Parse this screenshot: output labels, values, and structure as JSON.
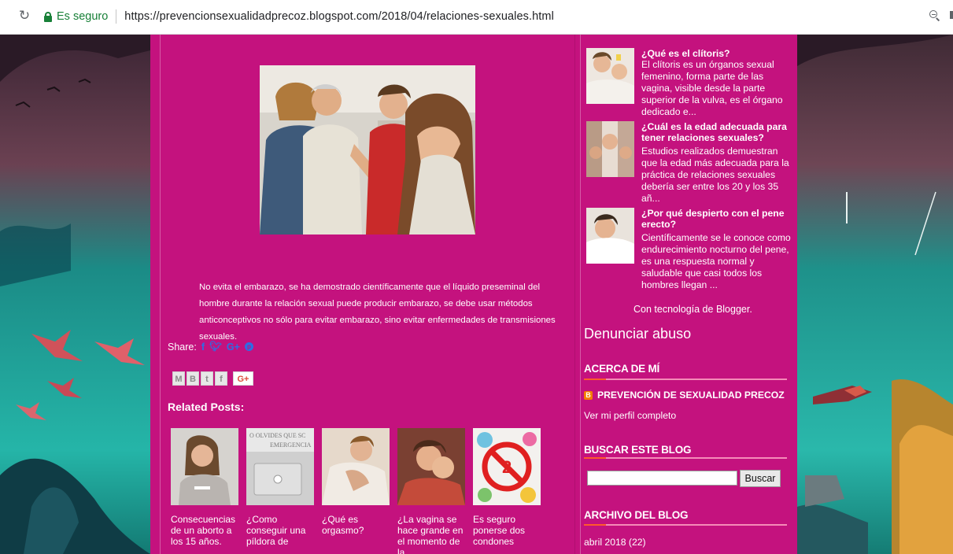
{
  "browser": {
    "secure_label": "Es seguro",
    "url": "https://prevencionsexualidadprecoz.blogspot.com/2018/04/relaciones-sexuales.html"
  },
  "post": {
    "body": "No evita el embarazo, se ha demostrado científicamente que el líquido preseminal  del hombre durante la relación sexual puede producir embarazo, se debe usar  métodos anticonceptivos no sólo para evitar embarazo, sino evitar enfermedades de transmisiones sexuales.",
    "share_label": "Share:",
    "share_icons": [
      "facebook-icon",
      "twitter-icon",
      "google-plus-icon",
      "pinterest-icon"
    ],
    "sharebar_icons": [
      "email-icon",
      "blogthis-icon",
      "twitter-icon",
      "facebook-icon",
      "google-plus-one-icon"
    ],
    "gplus_label": "G+"
  },
  "related": {
    "title": "Related Posts:",
    "items": [
      {
        "caption": "Consecuencias de un aborto a los 15 años."
      },
      {
        "caption": "¿Como conseguir una píldora de"
      },
      {
        "caption": "¿Qué es orgasmo?"
      },
      {
        "caption": "¿La vagina se hace grande en el momento de la"
      },
      {
        "caption": "Es seguro ponerse dos condones"
      }
    ]
  },
  "sidebar": {
    "popular_posts": [
      {
        "title": "¿Qué es el clítoris?",
        "snippet": "El clítoris es un órganos sexual femenino, forma parte de las vagina, visible desde la parte superior de la vulva, es el órgano dedicado e..."
      },
      {
        "title": "¿Cuál es la edad adecuada para tener relaciones sexuales?",
        "snippet": "Estudios realizados demuestran que la edad más adecuada para la práctica de relaciones sexuales debería ser entre los 20 y los 35 añ..."
      },
      {
        "title": "¿Por qué despierto con el pene erecto?",
        "snippet": "Científicamente se le conoce como endurecimiento nocturno del pene, es una respuesta normal y saludable que casi todos los hombres llegan ..."
      }
    ],
    "powered_by": "Con tecnología de Blogger.",
    "report_abuse": "Denunciar abuso",
    "about": {
      "title": "ACERCA DE MÍ",
      "blog_name": "PREVENCIÓN DE SEXUALIDAD PRECOZ",
      "view_profile": "Ver mi perfil completo"
    },
    "search": {
      "title": "BUSCAR ESTE BLOG",
      "button": "Buscar",
      "value": ""
    },
    "archive": {
      "title": "ARCHIVO DEL BLOG",
      "first_item": "abril 2018 (22)"
    }
  },
  "colors": {
    "blog_bg": "#c4127e",
    "widget_accent": "#ff5a2c",
    "share_blue": "#2c6ee6"
  }
}
